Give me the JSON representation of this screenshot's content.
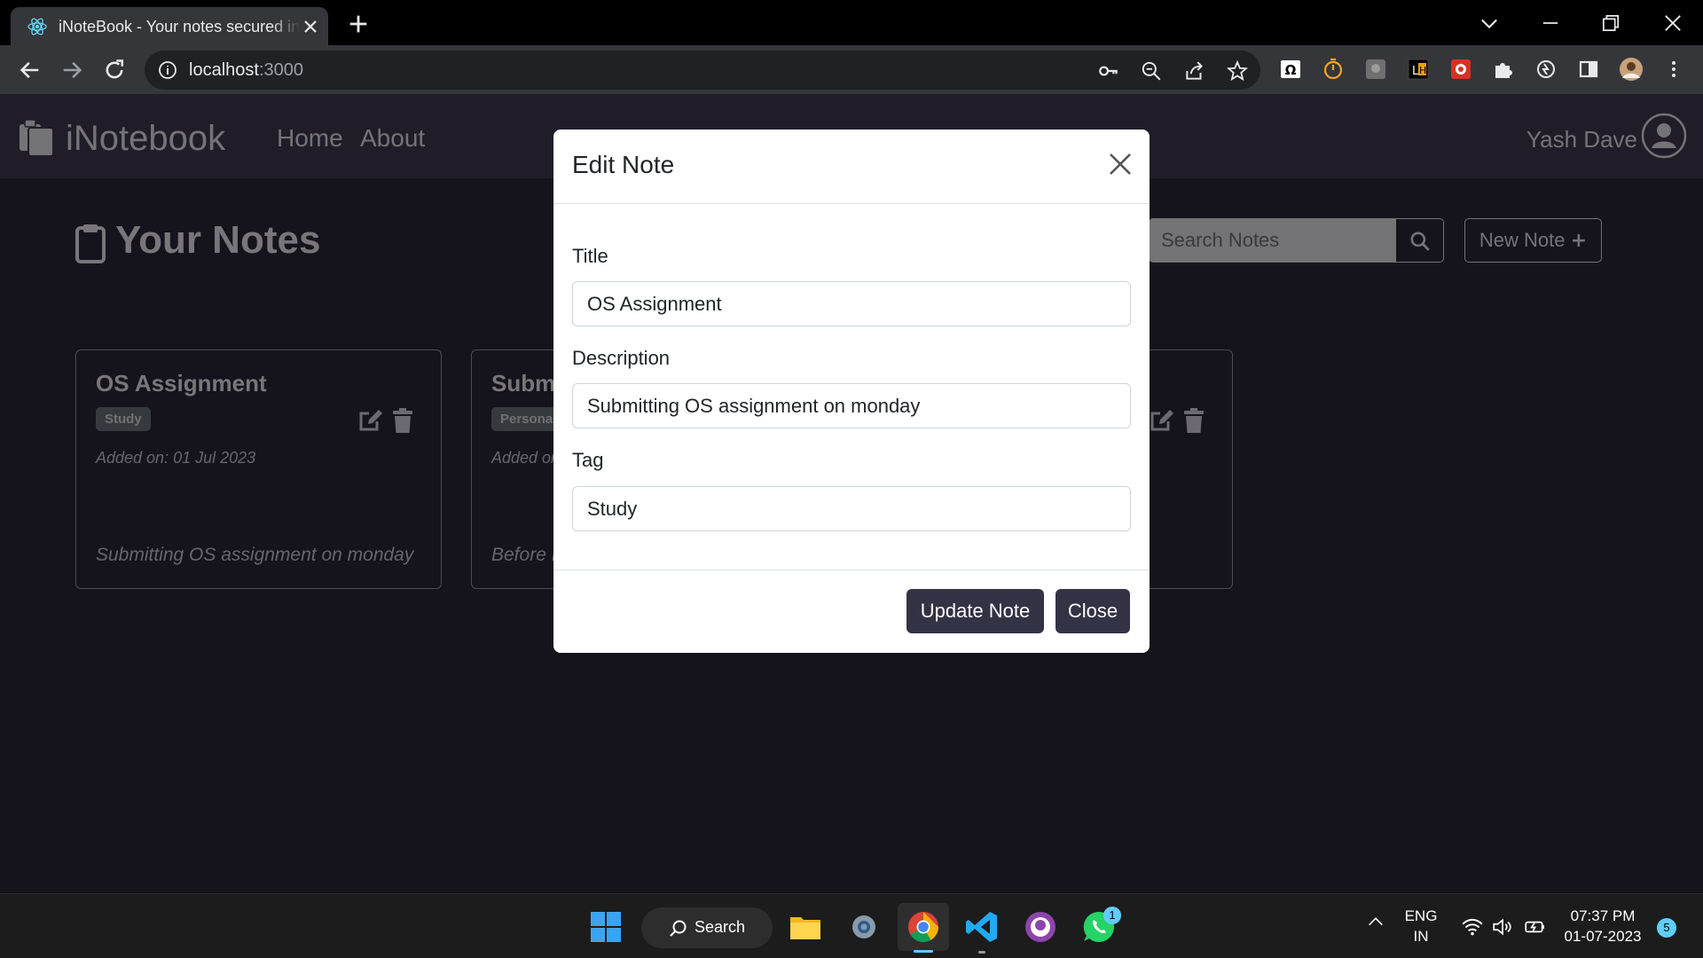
{
  "browser": {
    "tab_title": "iNoteBook - Your notes secured in the cloud",
    "url_host": "localhost",
    "url_port": ":3000"
  },
  "app": {
    "brand": "iNotebook",
    "nav": [
      "Home",
      "About"
    ],
    "user_name": "Yash Dave",
    "heading": "Your Notes",
    "search_placeholder": "Search Notes",
    "new_note_label": "New Note"
  },
  "notes": [
    {
      "title": "OS Assignment",
      "tag": "Study",
      "date": "Added on: 01 Jul 2023",
      "description": "Submitting OS assignment on monday"
    },
    {
      "title": "Subm",
      "tag": "Persona",
      "date": "Added on",
      "description": "Before F"
    }
  ],
  "modal": {
    "title": "Edit Note",
    "title_label": "Title",
    "title_value": "OS Assignment",
    "description_label": "Description",
    "description_value": "Submitting OS assignment on monday",
    "tag_label": "Tag",
    "tag_value": "Study",
    "update_label": "Update Note",
    "close_label": "Close"
  },
  "taskbar": {
    "search_label": "Search",
    "lang_top": "ENG",
    "lang_bottom": "IN",
    "time": "07:37 PM",
    "date": "01-07-2023",
    "notification_count": "5",
    "whatsapp_badge": "1"
  },
  "colors": {
    "navbar": "#413a52",
    "page_bg": "#2b2638",
    "button_dark": "#343245"
  }
}
